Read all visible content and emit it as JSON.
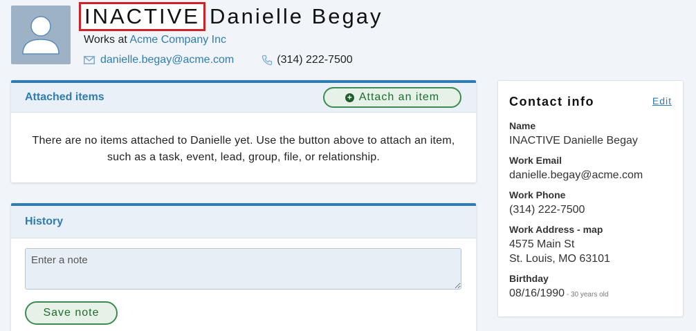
{
  "header": {
    "status_tag": "INACTIVE",
    "name": "Danielle Begay",
    "works_at_prefix": "Works at",
    "company": "Acme Company Inc",
    "email": "danielle.begay@acme.com",
    "phone": "(314) 222-7500",
    "icons": {
      "avatar": "person-placeholder",
      "email": "envelope-icon",
      "phone": "phone-icon"
    }
  },
  "attached": {
    "title": "Attached items",
    "button_label": "Attach an item",
    "empty_message": "There are no items attached to Danielle yet. Use the button above to attach an item, such as a task, event, lead, group, file, or relationship."
  },
  "history": {
    "title": "History",
    "note_placeholder": "Enter a note",
    "save_label": "Save note"
  },
  "contact_info": {
    "title": "Contact info",
    "edit_label": "Edit",
    "name_label": "Name",
    "name_value": "INACTIVE Danielle Begay",
    "email_label": "Work Email",
    "email_value": "danielle.begay@acme.com",
    "phone_label": "Work Phone",
    "phone_value": "(314) 222-7500",
    "address_label": "Work Address",
    "address_sep": " - ",
    "map_label": "map",
    "address_line1": "4575 Main St",
    "address_line2": "St. Louis, MO 63101",
    "birthday_label": "Birthday",
    "birthday_value": "08/16/1990",
    "age_note": " - 30 years old"
  },
  "colors": {
    "accent": "#2e7cb0",
    "link": "#2f7cb3",
    "inactive_border": "#d32027",
    "button_green": "#3d8a4f",
    "page_bg": "#f1f5f9"
  }
}
